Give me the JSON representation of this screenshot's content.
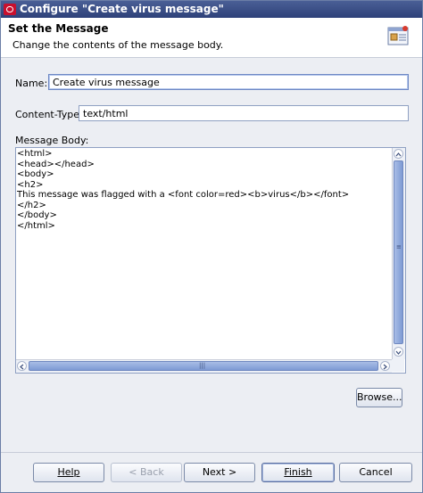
{
  "window": {
    "title": "Configure \"Create virus message\""
  },
  "header": {
    "title": "Set the Message",
    "subtitle": "Change the contents of the message body."
  },
  "form": {
    "name_label": "Name:",
    "name_value": "Create virus message",
    "content_type_label": "Content-Type:",
    "content_type_value": "text/html",
    "body_label": "Message Body:",
    "body_lines": [
      "<html>",
      "<head></head>",
      "<body>",
      "<h2>",
      "This message was flagged with a <font color=red><b>virus</b></font>",
      "</h2>",
      "</body>",
      "</html>"
    ],
    "browse_label": "Browse..."
  },
  "footer": {
    "help_label": "Help",
    "back_label": "< Back",
    "next_label": "Next >",
    "finish_label": "Finish",
    "cancel_label": "Cancel"
  },
  "icons": {
    "app": "oracle-icon",
    "header": "message-properties-icon"
  },
  "colors": {
    "titlebar": "#2e4179",
    "accent": "#7e9ad4"
  }
}
